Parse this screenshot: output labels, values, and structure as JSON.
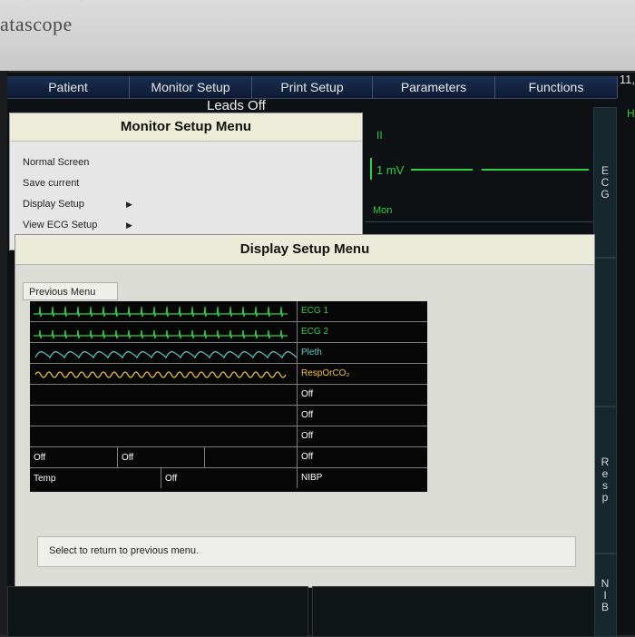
{
  "device": {
    "brand": "atascope"
  },
  "menubar": {
    "items": [
      "Patient",
      "Monitor Setup",
      "Print Setup",
      "Parameters",
      "Functions"
    ],
    "time": "11,"
  },
  "alarm": {
    "leads_off": "Leads Off"
  },
  "ecg": {
    "lead": "II",
    "scale": "1 mV",
    "mode": "Mon"
  },
  "side_tabs": {
    "top_label": "H",
    "ecg": [
      "E",
      "C",
      "G"
    ],
    "resp": [
      "R",
      "e",
      "s",
      "p"
    ],
    "nibp": [
      "N",
      "I",
      "B"
    ]
  },
  "monitor_setup_menu": {
    "title": "Monitor Setup Menu",
    "items": [
      "Normal Screen",
      "Save current",
      "Display Setup",
      "View ECG Setup"
    ]
  },
  "display_setup_menu": {
    "title": "Display Setup Menu",
    "previous_menu": "Previous Menu",
    "rows": [
      "ECG 1",
      "ECG 2",
      "Pleth",
      "RespOrCO₂",
      "Off",
      "Off",
      "Off",
      "Off",
      "NIBP"
    ],
    "bottom_left": [
      "Off",
      "Off"
    ],
    "temp_label": "Temp",
    "temp_value": "Off",
    "status": "Select to return to previous menu."
  },
  "colors": {
    "ecg_green": "#2fcf4a",
    "pleth_cyan": "#5ad1c8",
    "resp_yellow": "#f0c23c",
    "menu_bg": "#0b1a2e"
  }
}
